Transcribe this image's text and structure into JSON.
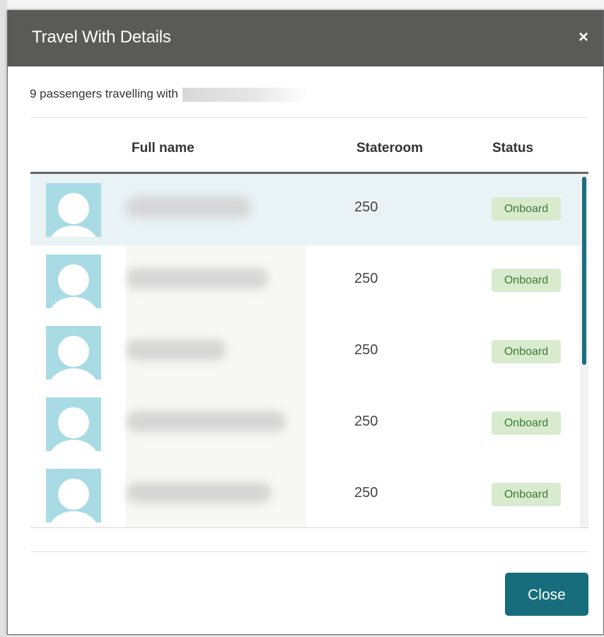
{
  "dialog": {
    "title": "Travel With Details",
    "close_glyph": "×",
    "subtitle_prefix": "9 passengers travelling with"
  },
  "table": {
    "columns": [
      "Full name",
      "Stateroom",
      "Status"
    ],
    "rows": [
      {
        "stateroom": "250",
        "status": "Onboard",
        "selected": true
      },
      {
        "stateroom": "250",
        "status": "Onboard",
        "selected": false
      },
      {
        "stateroom": "250",
        "status": "Onboard",
        "selected": false
      },
      {
        "stateroom": "250",
        "status": "Onboard",
        "selected": false
      },
      {
        "stateroom": "250",
        "status": "Onboard",
        "selected": false
      }
    ]
  },
  "footer": {
    "close_label": "Close"
  },
  "icons": {
    "avatar": "user-placeholder-icon",
    "close": "close-icon"
  },
  "colors": {
    "header_bg": "#5a5a59",
    "avatar_bg": "#a9dbe4",
    "status_badge_bg": "#d9ebcf",
    "status_badge_text": "#3c7a35",
    "primary_button": "#176d7b",
    "selected_row": "#e9f2f5",
    "scroll_thumb": "#1a6f7e"
  }
}
